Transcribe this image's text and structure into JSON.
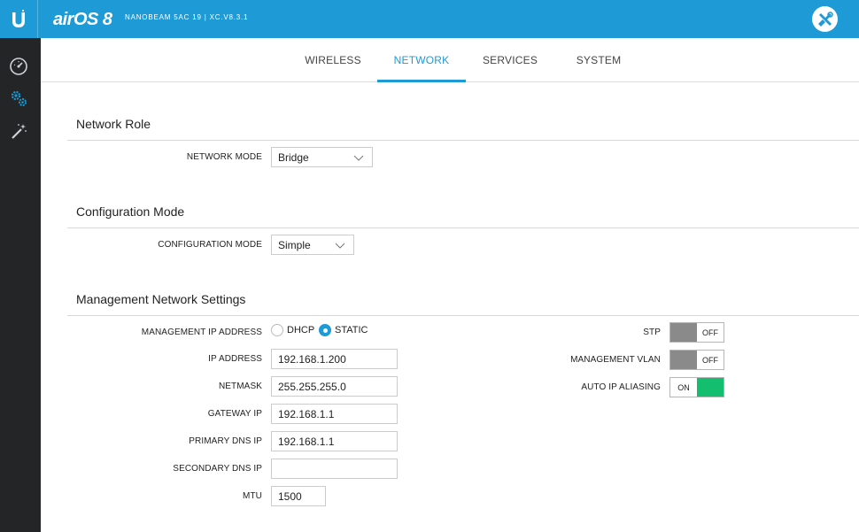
{
  "header": {
    "brand": "airOS 8",
    "device_info": "NANOBEAM 5AC 19 | XC.V8.3.1",
    "logo_icon": "ubiquiti-u-icon",
    "tools_icon": "tools-icon"
  },
  "sidebar": {
    "items": [
      {
        "icon": "dashboard-icon"
      },
      {
        "icon": "settings-gears-icon"
      },
      {
        "icon": "wizard-wand-icon"
      }
    ]
  },
  "tabs": [
    {
      "label": "WIRELESS"
    },
    {
      "label": "NETWORK",
      "active": true
    },
    {
      "label": "SERVICES"
    },
    {
      "label": "SYSTEM"
    }
  ],
  "network_role": {
    "title": "Network Role",
    "mode_label": "NETWORK MODE",
    "mode_value": "Bridge"
  },
  "configuration_mode": {
    "title": "Configuration Mode",
    "mode_label": "CONFIGURATION MODE",
    "mode_value": "Simple"
  },
  "management": {
    "title": "Management Network Settings",
    "ip_address_mode_label": "MANAGEMENT IP ADDRESS",
    "dhcp_label": "DHCP",
    "static_label": "STATIC",
    "selected": "STATIC",
    "fields": [
      {
        "label": "IP ADDRESS",
        "value": "192.168.1.200"
      },
      {
        "label": "NETMASK",
        "value": "255.255.255.0"
      },
      {
        "label": "GATEWAY IP",
        "value": "192.168.1.1"
      },
      {
        "label": "PRIMARY DNS IP",
        "value": "192.168.1.1"
      },
      {
        "label": "SECONDARY DNS IP",
        "value": ""
      },
      {
        "label": "MTU",
        "value": "1500"
      }
    ],
    "toggles": [
      {
        "label": "STP",
        "on_label": "ON",
        "off_label": "OFF",
        "state": "OFF"
      },
      {
        "label": "MANAGEMENT VLAN",
        "on_label": "ON",
        "off_label": "OFF",
        "state": "OFF"
      },
      {
        "label": "AUTO IP ALIASING",
        "on_label": "ON",
        "off_label": "OFF",
        "state": "ON"
      }
    ]
  },
  "colors": {
    "accent": "#1e9ad6",
    "sidebar": "#232527",
    "toggle_on": "#13bf6e",
    "toggle_off": "#8a8a8a"
  }
}
